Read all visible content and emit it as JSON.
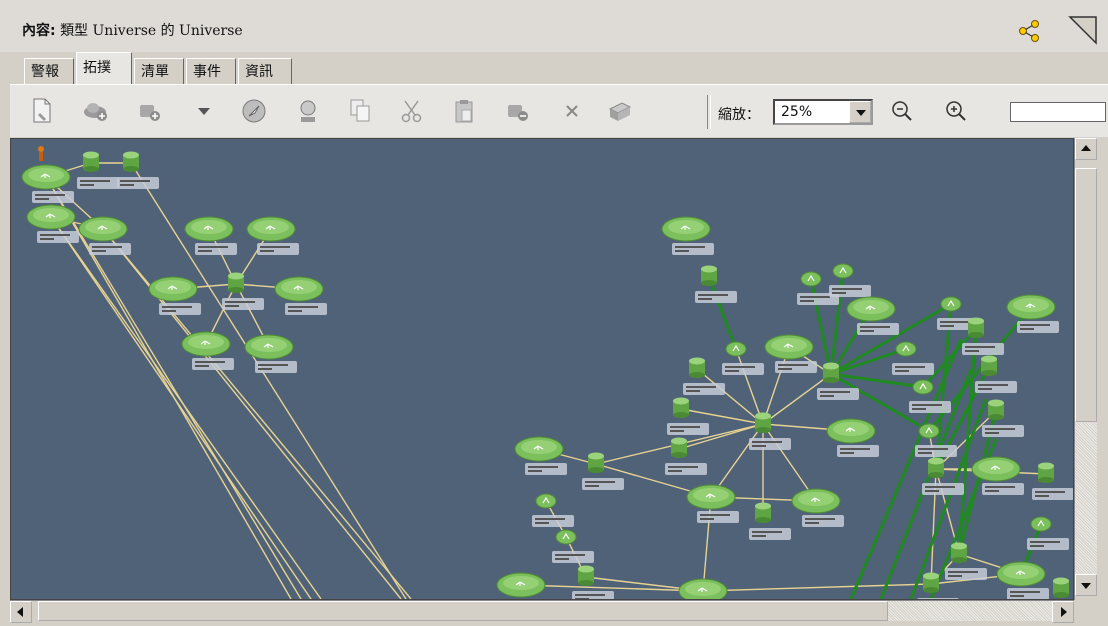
{
  "window": {
    "title_prefix": "內容:",
    "title_rest": "類型 Universe 的 Universe"
  },
  "tabs": [
    {
      "label": "警報",
      "active": false
    },
    {
      "label": "拓撲",
      "active": true
    },
    {
      "label": "清單",
      "active": false
    },
    {
      "label": "事件",
      "active": false
    },
    {
      "label": "資訊",
      "active": false
    }
  ],
  "toolbar": {
    "zoom_label": "縮放：",
    "zoom_value": "25%",
    "icons": [
      "new-document-icon",
      "add-cloud-icon",
      "add-node-icon",
      "dropdown-arrow-icon",
      "compass-icon",
      "find-icon",
      "copy-icon",
      "cut-icon",
      "paste-icon",
      "remove-icon",
      "delete-icon",
      "export-icon",
      "zoom-out-icon",
      "zoom-in-icon"
    ]
  },
  "topology": {
    "background": "#506277",
    "node_color": "#7cbf5d",
    "link_color_yellow": "#e6d394",
    "link_color_green": "#1f8a1f",
    "alarm_icon": "alarm-person-icon"
  }
}
